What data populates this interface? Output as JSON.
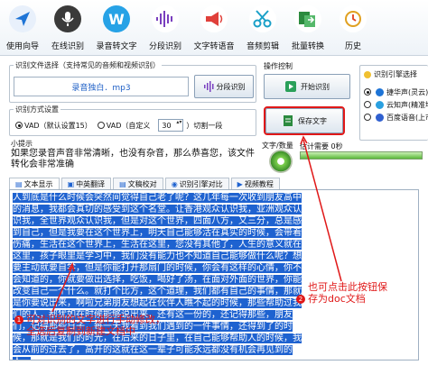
{
  "toolbar": {
    "items": [
      {
        "label": "使用向导",
        "icon": "navigation-arrow-icon",
        "color": "#1e74d6"
      },
      {
        "label": "在线识别",
        "icon": "microphone-icon",
        "color": "#2a2a2a"
      },
      {
        "label": "录音转文字",
        "icon": "w-logo-icon",
        "color": "#27a2e6"
      },
      {
        "label": "分段识别",
        "icon": "waveform-icon",
        "color": "#7a3fbf"
      },
      {
        "label": "文字转语音",
        "icon": "megaphone-icon",
        "color": "#e0403a"
      },
      {
        "label": "音频剪辑",
        "icon": "scissors-icon",
        "color": "#1aa0c8"
      },
      {
        "label": "批量转换",
        "icon": "batch-convert-icon",
        "color": "#2b8a3e"
      },
      {
        "label": "历史",
        "icon": "history-clock-icon",
        "color": "#e0a020"
      }
    ]
  },
  "file_section": {
    "title": "识别文件选择（支持常见的音频和视频识别）",
    "file_name": "录音独白．mp3",
    "split_button": "分段识别"
  },
  "mode_section": {
    "title": "识别方式设置",
    "option1": "VAD（默认设置15）",
    "option2": "VAD（自定义",
    "custom_value": "30",
    "suffix": "）切割一段"
  },
  "tips": {
    "title": "小提示",
    "text": "如果您录音声音非常清晰，也没有杂音，那么恭喜您，该文件转化会非常准确"
  },
  "operation": {
    "title": "操作控制",
    "start_button": "开始识别",
    "save_button": "保存文字",
    "status_label": "文字/数量",
    "estimate_label": "估计需要",
    "estimate_value": "0秒"
  },
  "engine": {
    "title": "识别引擎选择",
    "items": [
      {
        "label": "捷华声(灵云)",
        "color": "#1e74d6",
        "selected": true
      },
      {
        "label": "云知声(精准地识)",
        "color": "#2aa0e0",
        "selected": false
      },
      {
        "label": "百度语音(上市)",
        "color": "#3060d0",
        "selected": false
      }
    ]
  },
  "tabs": [
    "文本显示",
    "中英翻译",
    "文稿校对",
    "识别引擎对比",
    "视频教程"
  ],
  "content_text": "人到底是什么时候会突然间觉得自己老了呢？这几年每一次收到朋友高中的消息，我都会真切的感受到这个名堂。让香港观众认识我，亚洲观众认识我，全世界观众认识我，但是对这个世界，四面八方，又三分，总是感到自己，但是我要在这个世界上，明天自己能够活在真实的时候，会带着伤痛，生活在这个世界上，生活在这里，您没有其他了，人生的意义就在这里，孩子眼里是学习中，我们没有能力也不知道自己能够做什么呢？想要主动就要自学，但是你能打开那扇门的时候，你会有这样的心情，你不会知道的，你就要做出选择，吃饭，喝好了汤，在面对外面的世界，你能改变自己一个什么。就打个比方，这个道理，我们都有自己的事情，那就是你要说出来，啊啦兄弟朋友想起在伙伴人瞧不起的时候，那些帮助过我们的人，都犹如在时候能够说出来，还有这一份的，还记得那些，朋友们，记得那些日子，每一天我看到我们遇到的一件事情，还得到了的时候，那就是我们的时光，在后来的日子里，在自己能够帮助人的时候，我会从前的过去了，高开的这就在这一辈子可能永远都没有机会再见到的人。",
  "annotation1": {
    "badge": "1",
    "line1": "可对识别的文字进行手动修改，",
    "line2": "全选后复制到新建文档中"
  },
  "annotation2": {
    "badge": "2",
    "line1": "也可点击此按钮保",
    "line2": "存为doc文档"
  }
}
